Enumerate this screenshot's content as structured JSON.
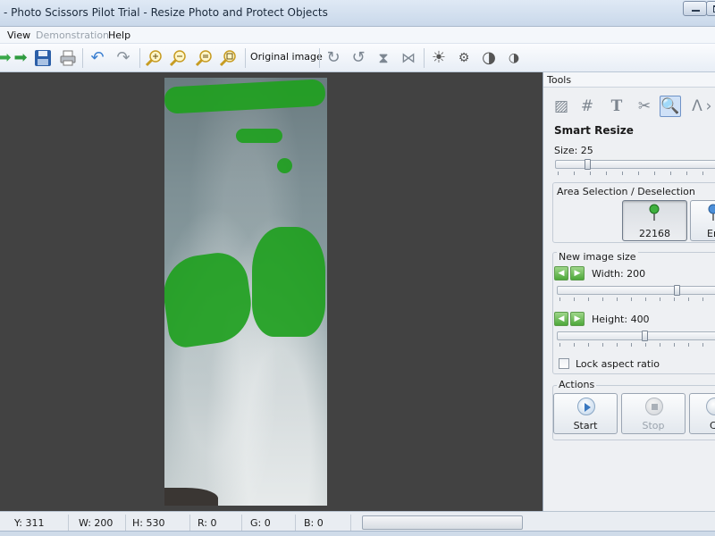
{
  "window": {
    "title": "- Photo Scissors Pilot Trial - Resize Photo and Protect Objects"
  },
  "menu": [
    {
      "label": "View",
      "enabled": true
    },
    {
      "label": "Demonstration",
      "enabled": false
    },
    {
      "label": "Help",
      "enabled": true
    }
  ],
  "toolbar": {
    "original_image_label": "Original image",
    "icons": [
      "back-arrow-icon",
      "forward-arrow-icon",
      "save-icon",
      "print-icon",
      "undo-icon",
      "redo-icon",
      "zoom-in-icon",
      "zoom-out-icon",
      "zoom-actual-icon",
      "zoom-fit-icon",
      "rotate-cw-icon",
      "rotate-ccw-icon",
      "flip-vertical-icon",
      "flip-horizontal-icon",
      "brightness-icon",
      "brightness-small-icon",
      "contrast-icon",
      "contrast-small-icon"
    ]
  },
  "panel": {
    "header": "Tools",
    "section_title": "Smart Resize",
    "size_label": "Size: 25",
    "size_value": 25,
    "area_selection": {
      "title": "Area Selection / Deselection",
      "keep_button_label": "22168",
      "erase_button_label": "Er"
    },
    "new_image_size": {
      "title": "New image size",
      "width_label": "Width: 200",
      "height_label": "Height: 400",
      "lock_aspect_label": "Lock aspect ratio",
      "lock_aspect_checked": false
    },
    "actions": {
      "title": "Actions",
      "start_label": "Start",
      "stop_label": "Stop",
      "third_label": "C"
    }
  },
  "status": {
    "y": "Y: 311",
    "w": "W: 200",
    "h": "H: 530",
    "r": "R: 0",
    "g": "G: 0",
    "b": "B: 0"
  },
  "colors": {
    "canvas_bg": "#424242",
    "selection_mask": "#1fa01f",
    "accent": "#2a6ab3"
  }
}
